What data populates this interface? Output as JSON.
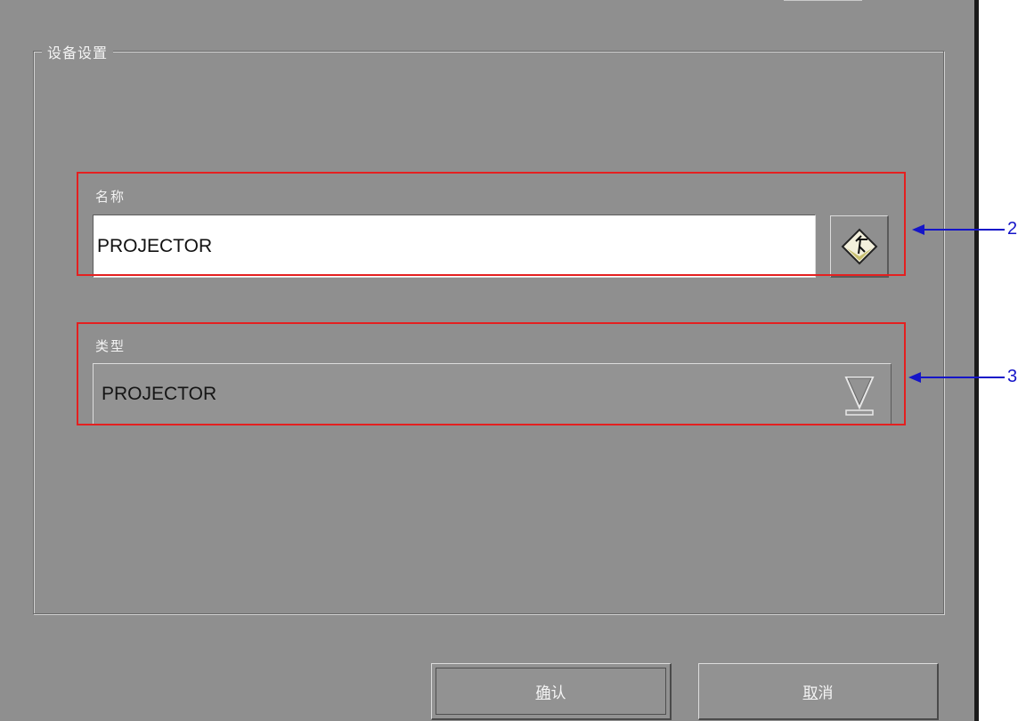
{
  "dialog": {
    "group_title": "设备设置",
    "name_field": {
      "label": "名称",
      "value": "PROJECTOR",
      "keyboard_icon": "keyboard-icon"
    },
    "type_field": {
      "label": "类型",
      "selected": "PROJECTOR",
      "arrow_icon": "dropdown-arrow-icon"
    },
    "buttons": {
      "ok": {
        "mnemonic": "确",
        "rest": "认"
      },
      "cancel": {
        "mnemonic": "取",
        "rest": "消"
      }
    }
  },
  "annotations": {
    "callout_2": "2",
    "callout_3": "3",
    "highlight_color": "#e42020",
    "callout_color": "#1515c8"
  }
}
